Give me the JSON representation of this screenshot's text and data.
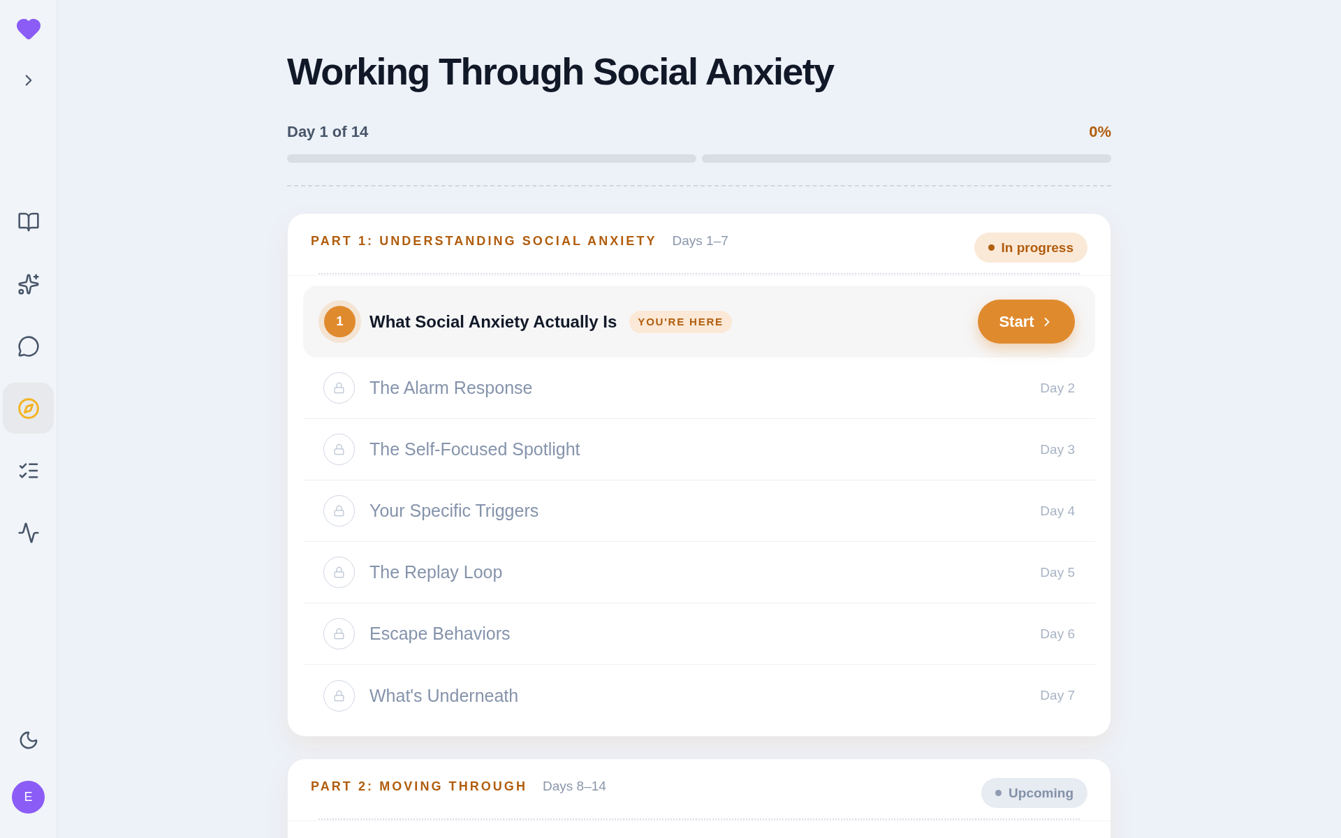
{
  "sidebar": {
    "nav": [
      {
        "selected": false
      },
      {
        "selected": false
      },
      {
        "selected": false
      },
      {
        "selected": true
      },
      {
        "selected": false
      },
      {
        "selected": false
      }
    ],
    "avatar": {
      "initial": "E"
    }
  },
  "title": "Working Through Social Anxiety",
  "progress": {
    "label": "Day 1 of 14",
    "percent": "0%",
    "segments": [
      {
        "level": 0
      },
      {
        "level": 0
      }
    ]
  },
  "parts": [
    {
      "title": "PART 1: UNDERSTANDING SOCIAL ANXIETY",
      "days": "Days 1–7",
      "status": {
        "kind": "in_progress",
        "label": "In progress"
      },
      "lessons": [
        {
          "kind": "current",
          "number": "1",
          "title": "What Social Anxiety Actually Is",
          "badge": "YOU'RE HERE",
          "action": "Start"
        },
        {
          "kind": "locked",
          "title": "The Alarm Response",
          "day": "Day 2"
        },
        {
          "kind": "locked",
          "title": "The Self-Focused Spotlight",
          "day": "Day 3"
        },
        {
          "kind": "locked",
          "title": "Your Specific Triggers",
          "day": "Day 4"
        },
        {
          "kind": "locked",
          "title": "The Replay Loop",
          "day": "Day 5"
        },
        {
          "kind": "locked",
          "title": "Escape Behaviors",
          "day": "Day 6"
        },
        {
          "kind": "locked",
          "title": "What's Underneath",
          "day": "Day 7"
        }
      ]
    },
    {
      "title": "PART 2: MOVING THROUGH",
      "days": "Days 8–14",
      "status": {
        "kind": "upcoming",
        "label": "Upcoming"
      }
    }
  ]
}
